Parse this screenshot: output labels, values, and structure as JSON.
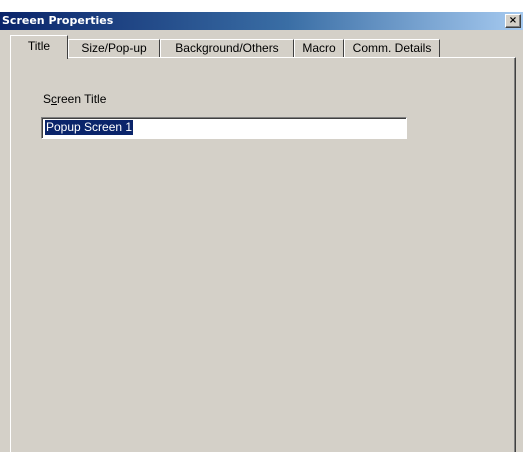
{
  "window": {
    "title": "Screen Properties",
    "close_glyph": "×",
    "close_icon": "close-icon"
  },
  "tabs": [
    {
      "label": "Title",
      "active": true
    },
    {
      "label": "Size/Pop-up",
      "active": false
    },
    {
      "label": "Background/Others",
      "active": false
    },
    {
      "label": "Macro",
      "active": false
    },
    {
      "label": "Comm. Details",
      "active": false
    }
  ],
  "title_tab": {
    "field_label_prefix": "S",
    "field_label_mnemonic": "c",
    "field_label_suffix": "reen Title",
    "field_value": "Popup Screen 1",
    "value_selected": true
  },
  "colors": {
    "face": "#d4d0c8",
    "titlebar_start": "#0a246a",
    "titlebar_end": "#a6caf0",
    "selection": "#0a246a"
  }
}
